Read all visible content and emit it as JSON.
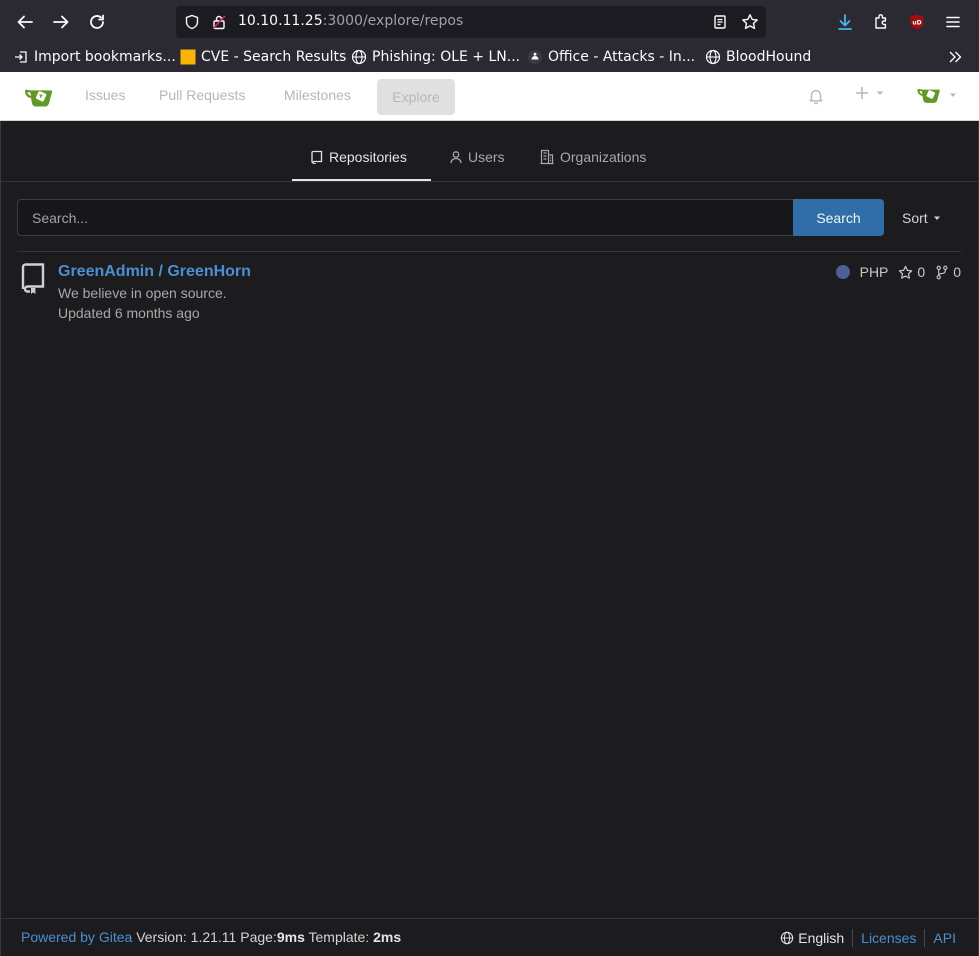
{
  "browser": {
    "url_host": "10.10.11.25",
    "url_path": ":3000/explore/repos",
    "bookmarks": [
      {
        "label": "Import bookmarks...",
        "icon": "import-icon"
      },
      {
        "label": "CVE - Search Results",
        "icon": "cve-favicon"
      },
      {
        "label": "Phishing: OLE + LN...",
        "icon": "globe-icon"
      },
      {
        "label": "Office - Attacks - In...",
        "icon": "site-favicon"
      },
      {
        "label": "BloodHound",
        "icon": "globe-icon"
      }
    ]
  },
  "gitea_nav": {
    "issues": "Issues",
    "pull_requests": "Pull Requests",
    "milestones": "Milestones",
    "explore": "Explore",
    "plus": "+"
  },
  "tabs": {
    "repositories": "Repositories",
    "users": "Users",
    "organizations": "Organizations"
  },
  "search": {
    "placeholder": "Search...",
    "button": "Search",
    "sort": "Sort"
  },
  "repo": {
    "name": "GreenAdmin / GreenHorn",
    "description": "We believe in open source.",
    "updated": "Updated 6 months ago",
    "language": "PHP",
    "language_color": "#4f5d95",
    "stars": "0",
    "forks": "0"
  },
  "footer": {
    "powered_by": "Powered by Gitea",
    "version_label": "Version: 1.21.11",
    "page_label": "Page:",
    "page_time": "9ms",
    "template_label": "Template:",
    "template_time": "2ms",
    "language": "English",
    "licenses": "Licenses",
    "api": "API"
  },
  "colors": {
    "accent": "#4b8fd1",
    "search_button": "#2f6ea8",
    "background": "#1c1c1e"
  }
}
